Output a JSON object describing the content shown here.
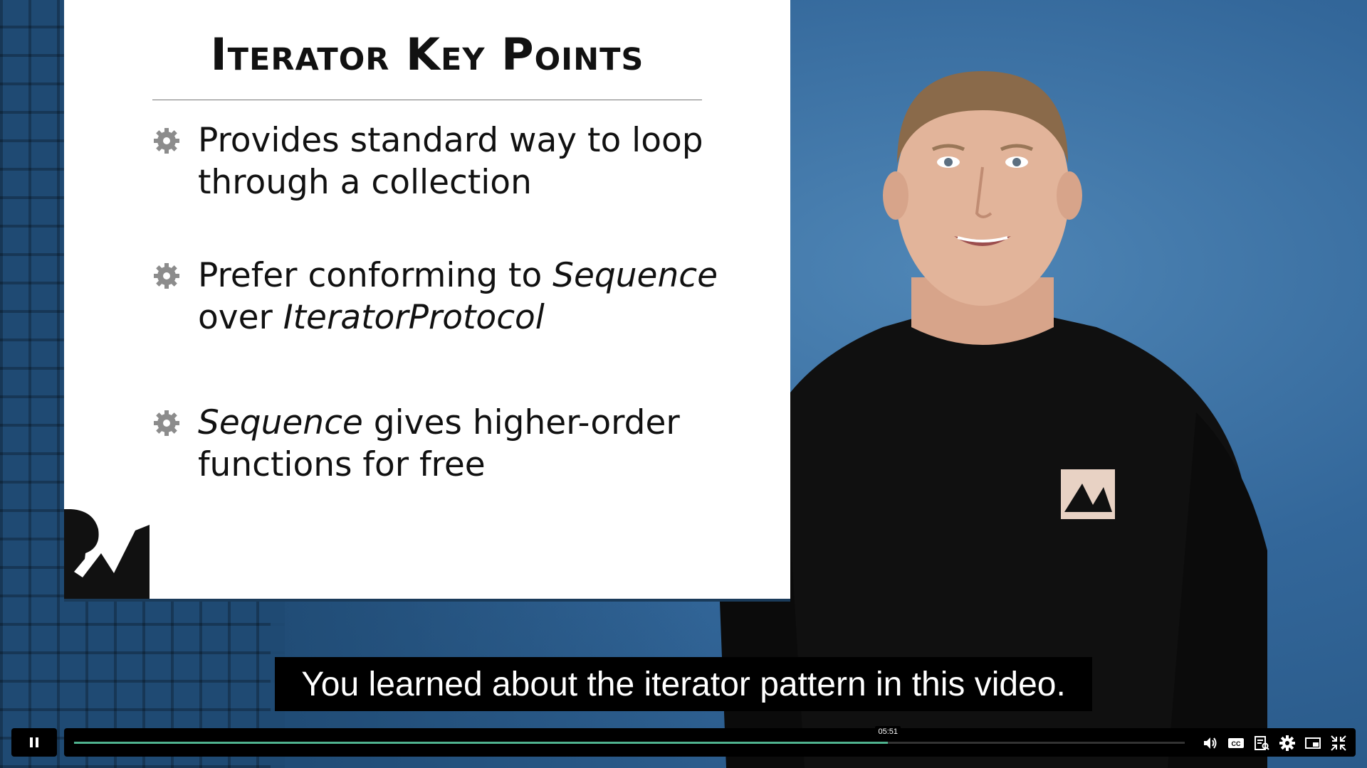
{
  "slide": {
    "title": "Iterator Key Points",
    "bullets": [
      {
        "line1_plain": "Provides standard way to loop",
        "line2_plain": "through a collection"
      },
      {
        "line1_plain": "Prefer conforming to ",
        "line1_italic": "Sequence",
        "line2_plain": "over ",
        "line2_italic": "IteratorProtocol"
      },
      {
        "line1_italic": "Sequence",
        "line1_plain": " gives higher-order",
        "line2_plain": "functions for free"
      }
    ]
  },
  "caption": "You learned about the iterator pattern in this video.",
  "player": {
    "time_tooltip": "05:51",
    "progress_fraction": 0.733,
    "state": "playing",
    "icons": [
      "pause-icon",
      "volume-icon",
      "closed-captions-icon",
      "transcript-icon",
      "settings-icon",
      "picture-in-picture-icon",
      "exit-fullscreen-icon"
    ]
  },
  "colors": {
    "progress": "#4fb38f",
    "background": "#2a5a86",
    "slide": "#ffffff"
  }
}
